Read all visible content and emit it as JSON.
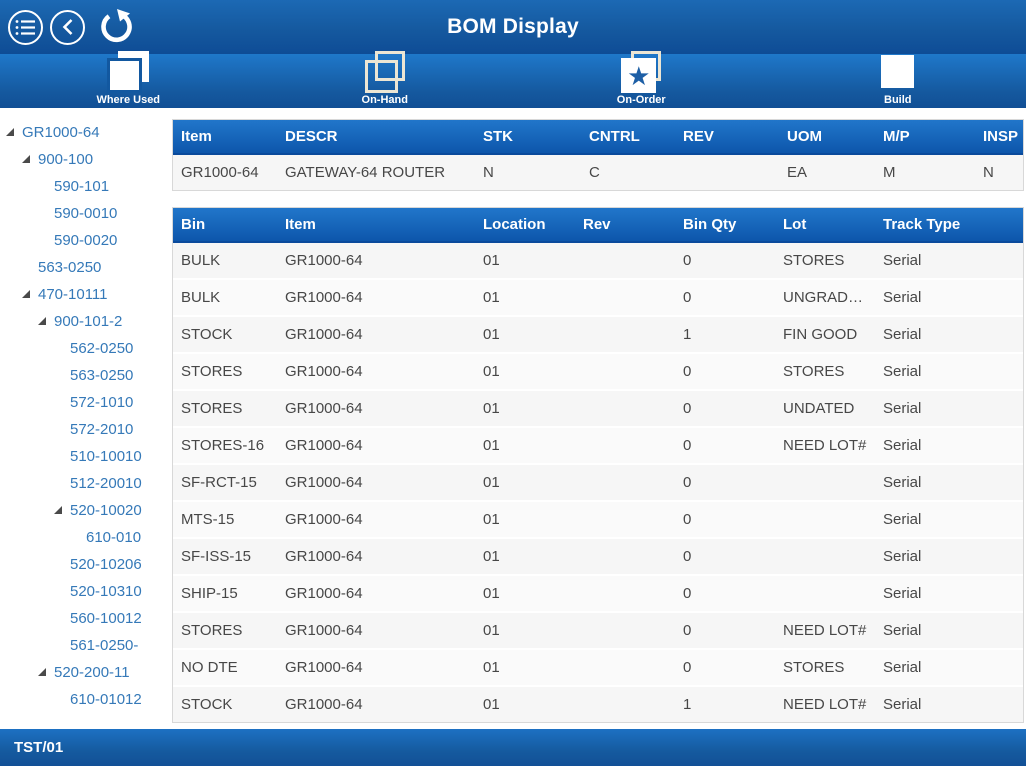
{
  "title_bar": {
    "title": "BOM Display",
    "icons": [
      "menu-icon",
      "back-icon",
      "refresh-icon"
    ]
  },
  "toolbar": {
    "buttons": [
      {
        "label": "Where Used",
        "icon": "where-used-icon",
        "icon_class": "icon-where-used"
      },
      {
        "label": "On-Hand",
        "icon": "on-hand-icon",
        "icon_class": "icon-on-hand"
      },
      {
        "label": "On-Order",
        "icon": "on-order-icon",
        "icon_class": "icon-on-order"
      },
      {
        "label": "Build",
        "icon": "build-icon",
        "icon_class": "icon-build"
      }
    ]
  },
  "tree": {
    "items": [
      {
        "label": "GR1000-64",
        "level": 0,
        "expanded": true
      },
      {
        "label": "900-100",
        "level": 1,
        "expanded": true
      },
      {
        "label": "590-101",
        "level": 2,
        "expanded": false
      },
      {
        "label": "590-0010",
        "level": 2,
        "expanded": false
      },
      {
        "label": "590-0020",
        "level": 2,
        "expanded": false
      },
      {
        "label": "563-0250",
        "level": 1,
        "expanded": false
      },
      {
        "label": "470-10111",
        "level": 1,
        "expanded": true
      },
      {
        "label": "900-101-2",
        "level": 2,
        "expanded": true
      },
      {
        "label": "562-0250",
        "level": 3,
        "expanded": false
      },
      {
        "label": "563-0250",
        "level": 3,
        "expanded": false
      },
      {
        "label": "572-1010",
        "level": 3,
        "expanded": false
      },
      {
        "label": "572-2010",
        "level": 3,
        "expanded": false
      },
      {
        "label": "510-10010",
        "level": 3,
        "expanded": false
      },
      {
        "label": "512-20010",
        "level": 3,
        "expanded": false
      },
      {
        "label": "520-10020",
        "level": 3,
        "expanded": true
      },
      {
        "label": "610-010",
        "level": 4,
        "expanded": false
      },
      {
        "label": "520-10206",
        "level": 3,
        "expanded": false
      },
      {
        "label": "520-10310",
        "level": 3,
        "expanded": false
      },
      {
        "label": "560-10012",
        "level": 3,
        "expanded": false
      },
      {
        "label": "561-0250-",
        "level": 3,
        "expanded": false
      },
      {
        "label": "520-200-11",
        "level": 2,
        "expanded": true
      },
      {
        "label": "610-01012",
        "level": 3,
        "expanded": false
      }
    ]
  },
  "item_table": {
    "columns": [
      "Item",
      "DESCR",
      "STK",
      "CNTRL",
      "REV",
      "UOM",
      "M/P",
      "INSP"
    ],
    "rows": [
      [
        "GR1000-64",
        "GATEWAY-64 ROUTER",
        "N",
        "C",
        "",
        "EA",
        "M",
        "N"
      ]
    ]
  },
  "bin_table": {
    "columns": [
      "Bin",
      "Item",
      "Location",
      "Rev",
      "Bin Qty",
      "Lot",
      "Track Type"
    ],
    "rows": [
      [
        "BULK",
        "GR1000-64",
        "01",
        "",
        "0",
        "STORES",
        "Serial"
      ],
      [
        "BULK",
        "GR1000-64",
        "01",
        "",
        "0",
        "UNGRADE...",
        "Serial"
      ],
      [
        "STOCK",
        "GR1000-64",
        "01",
        "",
        "1",
        "FIN GOOD",
        "Serial"
      ],
      [
        "STORES",
        "GR1000-64",
        "01",
        "",
        "0",
        "STORES",
        "Serial"
      ],
      [
        "STORES",
        "GR1000-64",
        "01",
        "",
        "0",
        "UNDATED",
        "Serial"
      ],
      [
        "STORES-16",
        "GR1000-64",
        "01",
        "",
        "0",
        "NEED LOT#",
        "Serial"
      ],
      [
        "SF-RCT-15",
        "GR1000-64",
        "01",
        "",
        "0",
        "",
        "Serial"
      ],
      [
        "MTS-15",
        "GR1000-64",
        "01",
        "",
        "0",
        "",
        "Serial"
      ],
      [
        "SF-ISS-15",
        "GR1000-64",
        "01",
        "",
        "0",
        "",
        "Serial"
      ],
      [
        "SHIP-15",
        "GR1000-64",
        "01",
        "",
        "0",
        "",
        "Serial"
      ],
      [
        "STORES",
        "GR1000-64",
        "01",
        "",
        "0",
        "NEED LOT#",
        "Serial"
      ],
      [
        "NO DTE",
        "GR1000-64",
        "01",
        "",
        "0",
        "STORES",
        "Serial"
      ],
      [
        "STOCK",
        "GR1000-64",
        "01",
        "",
        "1",
        "NEED LOT#",
        "Serial"
      ]
    ]
  },
  "status_bar": {
    "text": "TST/01"
  },
  "colors": {
    "bar_blue_top": "#1c69b4",
    "bar_blue_bottom": "#0e4c96",
    "grid_header_top": "#2176ca",
    "grid_header_bottom": "#0d56ab",
    "tree_link_blue": "#3579b8",
    "row_background": "#f6f6f6",
    "star_blue": "#1d5fa6"
  }
}
